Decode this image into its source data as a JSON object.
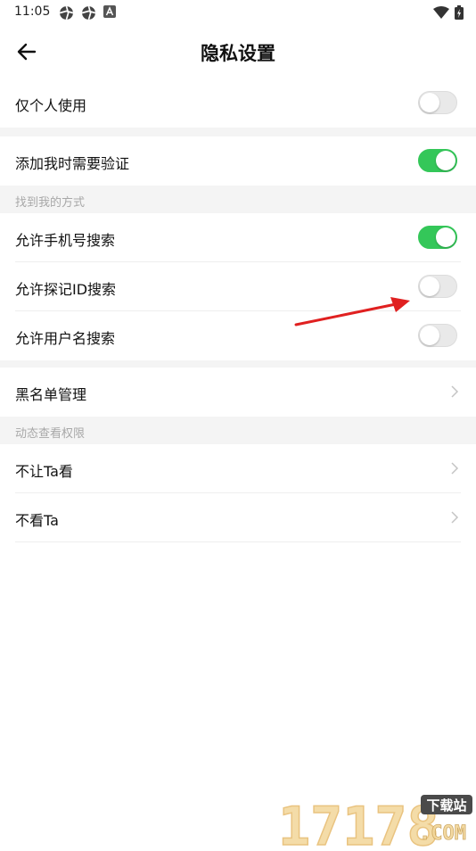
{
  "status_bar": {
    "time": "11:05"
  },
  "header": {
    "title": "隐私设置"
  },
  "rows": {
    "personal_use": {
      "label": "仅个人使用",
      "enabled": false
    },
    "add_verify": {
      "label": "添加我时需要验证",
      "enabled": true
    },
    "phone_search": {
      "label": "允许手机号搜索",
      "enabled": true
    },
    "id_search": {
      "label": "允许探记ID搜索",
      "enabled": false
    },
    "username_search": {
      "label": "允许用户名搜索",
      "enabled": false
    },
    "blacklist": {
      "label": "黑名单管理"
    },
    "hide_from": {
      "label": "不让Ta看"
    },
    "not_see": {
      "label": "不看Ta"
    }
  },
  "sections": {
    "find_me": "找到我的方式",
    "feed_permission": "动态查看权限"
  },
  "colors": {
    "toggle_on": "#34c759",
    "toggle_off": "#e9e9e9",
    "arrow": "#e02020"
  },
  "watermark": {
    "number": "17178",
    "site": "下载站",
    "domain": ".COM"
  }
}
